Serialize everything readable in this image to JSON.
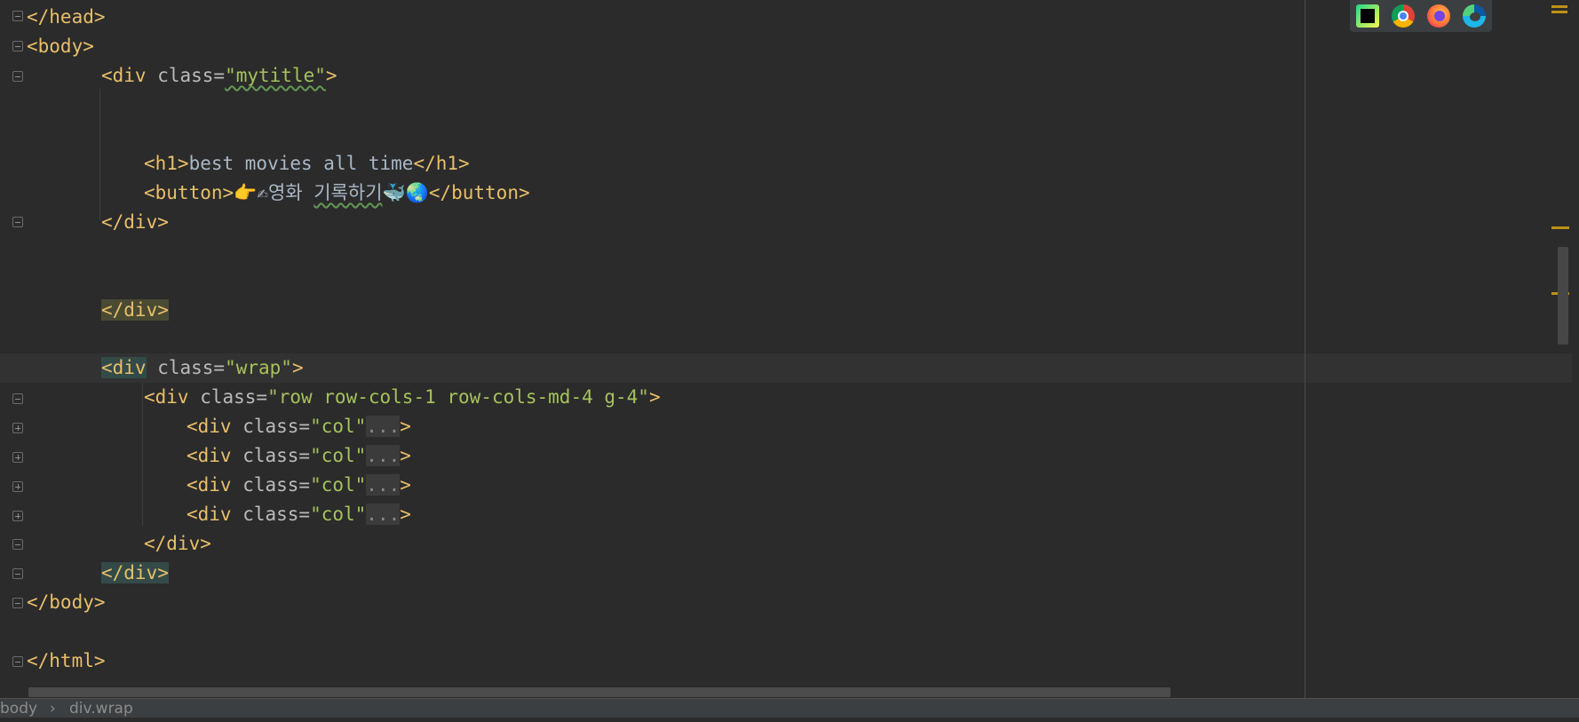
{
  "editor": {
    "lines": {
      "head_close": "</head>",
      "body_open": "<body>",
      "mytitle_open": {
        "tag_a": "<div ",
        "attr": "class=",
        "val": "\"mytitle\"",
        "tag_b": ">"
      },
      "h1": {
        "open": "<h1>",
        "text": "best movies all time",
        "close": "</h1>"
      },
      "button": {
        "open": "<button>",
        "emoji_a": "👉✍",
        "text_a": "영화 ",
        "text_b": "기록하기",
        "emoji_b": "🐳🌏",
        "close": "</button>"
      },
      "div_close_1": "</div>",
      "div_close_2": "</div>",
      "wrap_open": {
        "tag_a": "<div",
        "attr": " class=",
        "val": "\"wrap\"",
        "tag_b": ">"
      },
      "row_open": {
        "tag_a": "<div ",
        "attr": "class=",
        "val": "\"row row-cols-1 row-cols-md-4 g-4\"",
        "tag_b": ">"
      },
      "col": {
        "tag_a": "<div ",
        "attr": "class=",
        "val": "\"col\"",
        "fold": "...",
        "tag_b": ">"
      },
      "row_close": "</div>",
      "wrap_close": "</div>",
      "body_close": "</body>",
      "html_close": "</html>"
    }
  },
  "browsers": [
    "pycharm-icon",
    "chrome-icon",
    "firefox-icon",
    "edge-icon"
  ],
  "statusbar": {
    "crumb_1": "body",
    "crumb_2": "div.wrap"
  },
  "colors": {
    "background": "#2b2b2b",
    "tag": "#e8bf6a",
    "string": "#a5c25c",
    "attribute": "#bababa",
    "marker": "#be9117"
  }
}
